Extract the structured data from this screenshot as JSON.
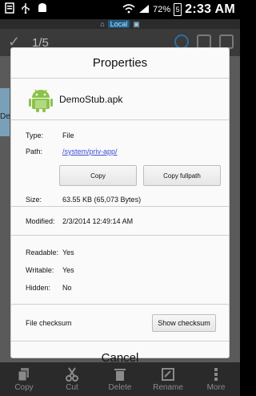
{
  "statusbar": {
    "battery_percent": "72%",
    "battery_level": "5",
    "time": "2:33 AM",
    "icons": [
      "usb-icon",
      "usb-icon",
      "android-icon",
      "wifi-icon",
      "signal-icon",
      "battery-icon"
    ]
  },
  "app": {
    "location_label": "Local",
    "selection_count": "1/5",
    "partial_text_left": "De"
  },
  "dialog": {
    "title": "Properties",
    "file_name": "DemoStub.apk",
    "type_label": "Type:",
    "type_value": "File",
    "path_label": "Path:",
    "path_value": "/system/priv-app/",
    "copy_label": "Copy",
    "copy_fullpath_label": "Copy fullpath",
    "size_label": "Size:",
    "size_value": "63.55 KB (65,073 Bytes)",
    "modified_label": "Modified:",
    "modified_value": "2/3/2014 12:49:14 AM",
    "readable_label": "Readable:",
    "readable_value": "Yes",
    "writable_label": "Writable:",
    "writable_value": "Yes",
    "hidden_label": "Hidden:",
    "hidden_value": "No",
    "checksum_label": "File checksum",
    "show_checksum_label": "Show checksum",
    "cancel_label": "Cancel"
  },
  "bottombar": {
    "items": [
      {
        "label": "Copy",
        "icon": "copy-icon"
      },
      {
        "label": "Cut",
        "icon": "cut-icon"
      },
      {
        "label": "Delete",
        "icon": "delete-icon"
      },
      {
        "label": "Rename",
        "icon": "rename-icon"
      },
      {
        "label": "More",
        "icon": "more-icon"
      }
    ]
  },
  "colors": {
    "link": "#3a4fd4",
    "android_green": "#8bc34a",
    "location_badge": "#1d5b86"
  }
}
